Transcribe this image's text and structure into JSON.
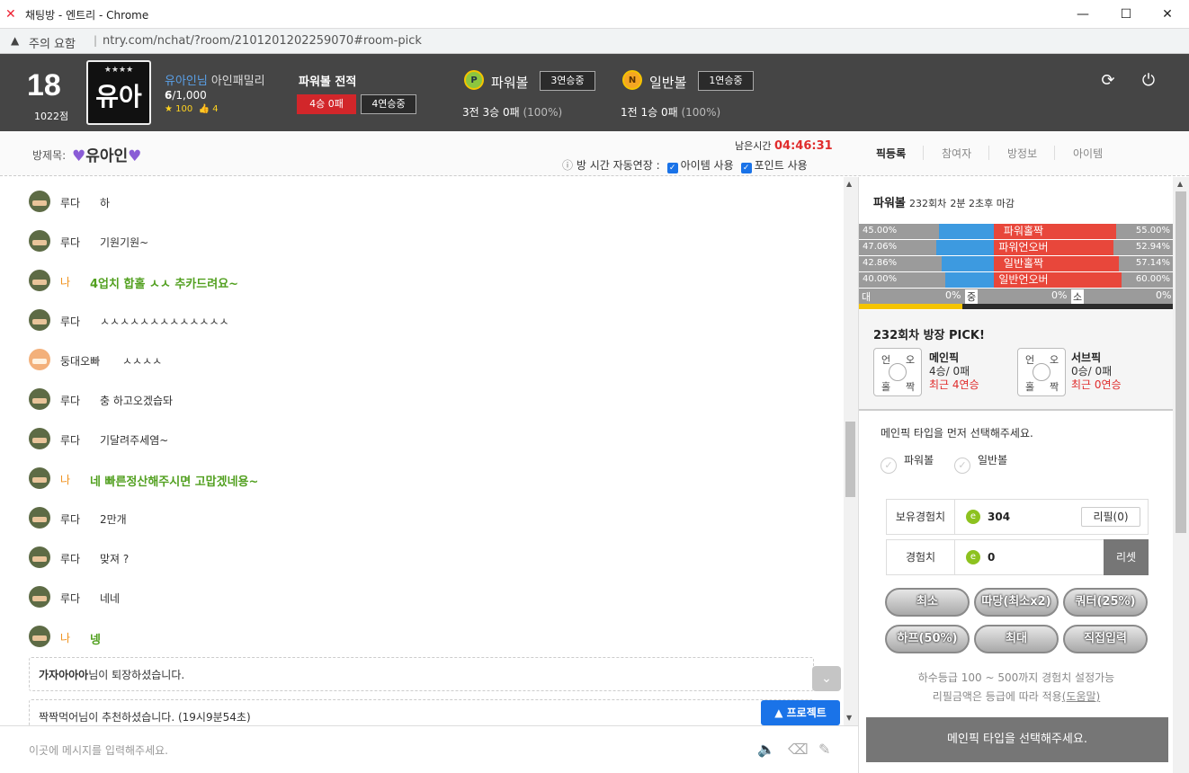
{
  "window": {
    "title": "채팅방 - 엔트리 - Chrome",
    "minimize": "—",
    "maximize": "☐",
    "close": "✕"
  },
  "address": {
    "warning": "주의 요함",
    "url": "ntry.com/nchat/?room/2101201202259070#room-pick"
  },
  "user": {
    "level": "18",
    "points": "1022점",
    "avatar_text": "유아인",
    "avatar_stars": "★★★★",
    "name": "유아인님",
    "family": "아인패밀리",
    "count_now": "6",
    "count_max": "/1,000",
    "stars": "100",
    "likes": "4"
  },
  "record": {
    "title": "파워볼 전적",
    "result": "4승 0패",
    "streak": "4연승중"
  },
  "games": [
    {
      "icon": "P",
      "name": "파워볼",
      "streak": "3연승중",
      "result": "3전 3승 0패",
      "pct": "(100%)"
    },
    {
      "icon": "N",
      "name": "일반볼",
      "streak": "1연승중",
      "result": "1전 1승 0패",
      "pct": "(100%)"
    }
  ],
  "room": {
    "label": "방제목:",
    "name": "유아인",
    "remain_label": "남은시간",
    "remain_time": "04:46:31",
    "auto_extend": "방 시간 자동연장 :",
    "opt_item": "아이템 사용",
    "opt_point": "포인트 사용"
  },
  "tabs": [
    "픽등록",
    "참여자",
    "방정보",
    "아이템"
  ],
  "messages": [
    {
      "who": "루다",
      "text": "하",
      "me": false
    },
    {
      "who": "루다",
      "text": "기원기원~",
      "me": false
    },
    {
      "who": "나",
      "text": "4업치 합홀 ㅅㅅ 추카드려요~",
      "me": true
    },
    {
      "who": "루다",
      "text": "ㅅㅅㅅㅅㅅㅅㅅㅅㅅㅅㅅㅅㅅ",
      "me": false
    },
    {
      "who": "둥대오빠",
      "text": "ㅅㅅㅅㅅ",
      "me": false
    },
    {
      "who": "루다",
      "text": "충 하고오겠습돠",
      "me": false
    },
    {
      "who": "루다",
      "text": "기달려주세염~",
      "me": false
    },
    {
      "who": "나",
      "text": "네 빠른정산해주시면 고맙겠네용~",
      "me": true
    },
    {
      "who": "루다",
      "text": "2만개",
      "me": false
    },
    {
      "who": "루다",
      "text": "맞져 ?",
      "me": false
    },
    {
      "who": "루다",
      "text": "네네",
      "me": false
    },
    {
      "who": "나",
      "text": "넹",
      "me": true
    }
  ],
  "system": [
    {
      "name": "가자아아아",
      "text": "님이 퇴장하셨습니다."
    },
    {
      "name": "짝짝먹어",
      "text": "님이 추천하셨습니다. (19시9분54초)"
    }
  ],
  "project_btn": "▲ 프로젝트",
  "input_placeholder": "이곳에 메시지를 입력해주세요.",
  "panel": {
    "round": "파워볼",
    "round_no": "232회차",
    "round_time": "2분 2초후 마감",
    "bars": [
      {
        "label": "파워홀짝",
        "left": "45.00%",
        "right": "55.00%",
        "left_val": 45.0,
        "right_val": 55.0
      },
      {
        "label": "파워언오버",
        "left": "47.06%",
        "right": "52.94%",
        "left_val": 47.06,
        "right_val": 52.94
      },
      {
        "label": "일반홀짝",
        "left": "42.86%",
        "right": "57.14%",
        "left_val": 42.86,
        "right_val": 57.14
      },
      {
        "label": "일반언오버",
        "left": "40.00%",
        "right": "60.00%",
        "left_val": 40.0,
        "right_val": 60.0
      }
    ],
    "size": [
      {
        "k": "대",
        "v": "0%"
      },
      {
        "k": "중",
        "v": "0%"
      },
      {
        "k": "소",
        "v": "0%"
      }
    ],
    "pick_title": "232회차 방장 PICK!",
    "pick_grid": [
      "언",
      "오",
      "홀",
      "짝"
    ],
    "main_pick": {
      "title": "메인픽",
      "rec": "4승/ 0패",
      "recent": "최근 4연승"
    },
    "sub_pick": {
      "title": "서브픽",
      "rec": "0승/ 0패",
      "recent": "최근 0연승"
    },
    "hint": "메인픽 타입을 먼저 선택해주세요.",
    "radio": [
      "파워볼",
      "일반볼"
    ],
    "exp_label": "보유경험치",
    "exp_value": "304",
    "refill": "리필(0)",
    "exp2_label": "경험치",
    "exp2_value": "0",
    "reset": "리셋",
    "buttons": [
      "최소",
      "따당(최소x2)",
      "쿼터(25%)",
      "하프(50%)",
      "최대",
      "직접입력"
    ],
    "note1": "하수등급 100 ~ 500까지 경험치 설정가능",
    "note2": "리필금액은 등급에 따라 적용",
    "note2_link": "(도움말)",
    "bottom": "메인픽 타입을 선택해주세요."
  }
}
